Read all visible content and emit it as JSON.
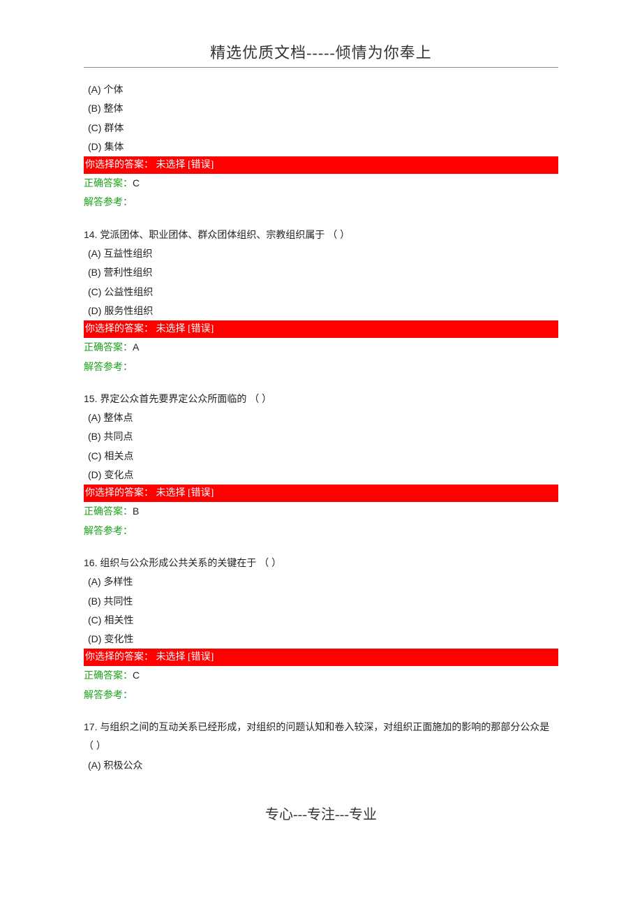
{
  "header": "精选优质文档-----倾情为你奉上",
  "footer": "专心---专注---专业",
  "answer_bar_text": "你选择的答案：  未选择  [错误]",
  "correct_label": "正确答案：",
  "explain_label": "解答参考：",
  "q13": {
    "options": {
      "a": "(A) 个体",
      "b": "(B) 整体",
      "c": "(C) 群体",
      "d": "(D) 集体"
    },
    "correct": "C"
  },
  "q14": {
    "number": "14.",
    "text": "党派团体、职业团体、群众团体组织、宗教组织属于 （ ）",
    "options": {
      "a": "(A) 互益性组织",
      "b": "(B) 营利性组织",
      "c": "(C) 公益性组织",
      "d": "(D) 服务性组织"
    },
    "correct": "A"
  },
  "q15": {
    "number": "15.",
    "text": "界定公众首先要界定公众所面临的 （ ）",
    "options": {
      "a": "(A) 整体点",
      "b": "(B) 共同点",
      "c": "(C) 相关点",
      "d": "(D) 变化点"
    },
    "correct": "B"
  },
  "q16": {
    "number": "16.",
    "text": "组织与公众形成公共关系的关键在于 （ ）",
    "options": {
      "a": "(A) 多样性",
      "b": "(B) 共同性",
      "c": "(C) 相关性",
      "d": "(D) 变化性"
    },
    "correct": "C"
  },
  "q17": {
    "number": "17.",
    "text": "与组织之间的互动关系已经形成，对组织的问题认知和卷入较深，对组织正面施加的影响的那部分公众是 （ ）",
    "options": {
      "a": "(A) 积极公众"
    }
  }
}
